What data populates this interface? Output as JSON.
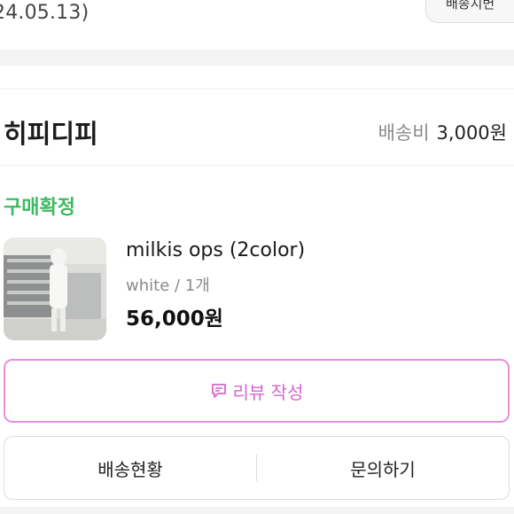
{
  "order": {
    "date": "24.05.13)",
    "corner_button": "배송지변"
  },
  "seller": {
    "name": "히피디피",
    "shipping_label": "배송비",
    "shipping_fee": "3,000원"
  },
  "item": {
    "status": "구매확정",
    "status_color": "#3dbb61",
    "name": "milkis ops (2color)",
    "option": "white / 1개",
    "price": "56,000원",
    "thumbnail_icon": "product-photo"
  },
  "actions": {
    "review_label": "리뷰 작성",
    "review_icon": "comment-icon",
    "review_color": "#d865cf",
    "delivery_status_label": "배송현황",
    "inquiry_label": "문의하기"
  }
}
